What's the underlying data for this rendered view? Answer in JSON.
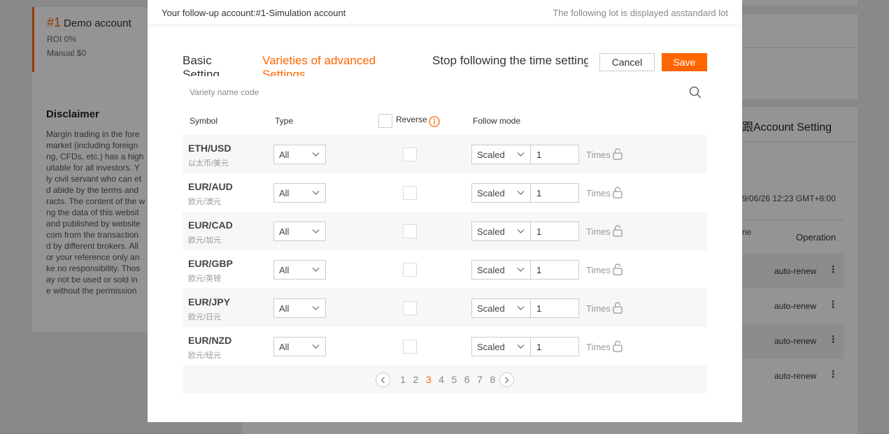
{
  "background": {
    "left_card": {
      "num": "#1",
      "name": "Demo account",
      "roi": "ROI 0%",
      "manual": "Manual $0"
    },
    "disclaimer": {
      "title": "Disclaimer",
      "lines": [
        "Margin trading in the fore",
        "market (including foreign",
        "ng, CFDs, etc.) has a high",
        "uitable for all investors. Y",
        "ly civil servant who can et",
        "d abide by the terms and",
        "racts. The content of the w",
        "ng the data of this websit",
        "and published by website",
        "com from the transaction",
        "d by different brokers. All",
        "or your reference only an",
        "ke no responsibility. Thos",
        "ay not be used or sold in",
        "e without the permission"
      ]
    },
    "right": {
      "title": "跟Account Setting",
      "time": "9/06/26 12:23 GMT+8:00",
      "col_partial": "ne",
      "operation": "Operation",
      "rows": [
        "auto-renew",
        "auto-renew",
        "auto-renew",
        "auto-renew"
      ]
    }
  },
  "modal": {
    "follow_account": "Your follow-up account:#1-Simulation account",
    "lot_note": "The following lot is displayed asstandard lot",
    "tabs": [
      {
        "label": "Basic Setting"
      },
      {
        "label": "Varieties of advanced Settings"
      },
      {
        "label": "Stop following the time setting"
      }
    ],
    "cancel_label": "Cancel",
    "save_label": "Save",
    "search_placeholder": "Variety name code",
    "headers": {
      "symbol": "Symbol",
      "type": "Type",
      "reverse": "Reverse",
      "follow_mode": "Follow mode"
    },
    "rows": [
      {
        "symbol": "ETH/USD",
        "sub": "以太币/美元",
        "type": "All",
        "mode": "Scaled",
        "value": "1",
        "unit": "Times"
      },
      {
        "symbol": "EUR/AUD",
        "sub": "欧元/澳元",
        "type": "All",
        "mode": "Scaled",
        "value": "1",
        "unit": "Times"
      },
      {
        "symbol": "EUR/CAD",
        "sub": "欧元/加元",
        "type": "All",
        "mode": "Scaled",
        "value": "1",
        "unit": "Times"
      },
      {
        "symbol": "EUR/GBP",
        "sub": "欧元/英镑",
        "type": "All",
        "mode": "Scaled",
        "value": "1",
        "unit": "Times"
      },
      {
        "symbol": "EUR/JPY",
        "sub": "欧元/日元",
        "type": "All",
        "mode": "Scaled",
        "value": "1",
        "unit": "Times"
      },
      {
        "symbol": "EUR/NZD",
        "sub": "欧元/纽元",
        "type": "All",
        "mode": "Scaled",
        "value": "1",
        "unit": "Times"
      }
    ],
    "pagination": {
      "pages": [
        "1",
        "2",
        "3",
        "4",
        "5",
        "6",
        "7",
        "8"
      ],
      "current": "3"
    },
    "colors": {
      "accent": "#ff6600"
    }
  }
}
